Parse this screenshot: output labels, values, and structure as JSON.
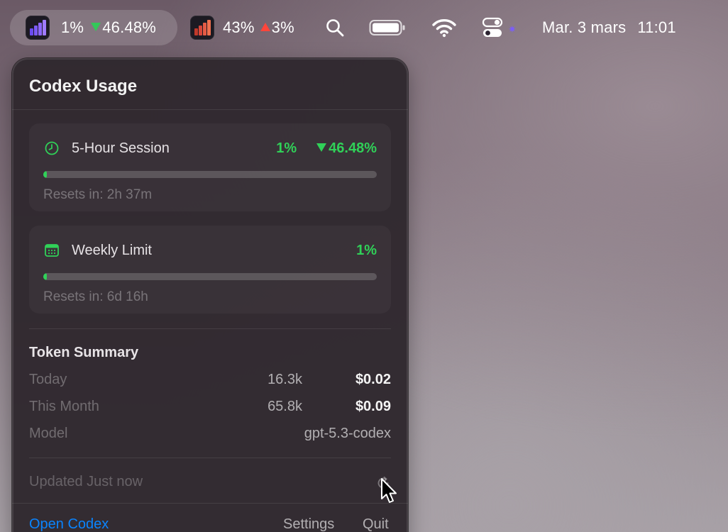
{
  "menubar": {
    "codex_item": {
      "percent": "1%",
      "delta": "46.48%",
      "icon": "codex-usage-app-icon"
    },
    "second_item": {
      "percent": "43%",
      "delta": "3%",
      "icon": "usage-app-icon-red"
    },
    "icons": [
      "search-icon",
      "battery-icon",
      "wifi-icon",
      "control-center-icon"
    ],
    "date": "Mar. 3 mars",
    "time": "11:01"
  },
  "popover": {
    "title": "Codex Usage",
    "session": {
      "label": "5-Hour Session",
      "percent": "1%",
      "delta": "46.48%",
      "progress": 0.01,
      "reset": "Resets in: 2h 37m",
      "icon": "clock-icon"
    },
    "weekly": {
      "label": "Weekly Limit",
      "percent": "1%",
      "progress": 0.01,
      "reset": "Resets in: 6d 16h",
      "icon": "calendar-icon"
    },
    "tokens": {
      "title": "Token Summary",
      "rows": [
        {
          "label": "Today",
          "tokens": "16.3k",
          "cost": "$0.02"
        },
        {
          "label": "This Month",
          "tokens": "65.8k",
          "cost": "$0.09"
        }
      ],
      "model_label": "Model",
      "model_value": "gpt-5.3-codex"
    },
    "updated": "Updated Just now",
    "footer": {
      "open": "Open Codex",
      "settings": "Settings",
      "quit": "Quit"
    }
  },
  "colors": {
    "accent_green": "#30d158",
    "accent_blue": "#0a84ff",
    "delta_up_red": "#ff453a"
  }
}
